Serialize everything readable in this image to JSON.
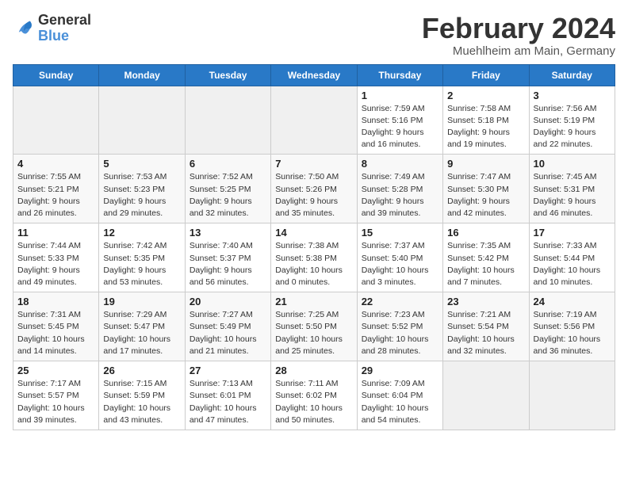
{
  "header": {
    "logo_line1": "General",
    "logo_line2": "Blue",
    "month_title": "February 2024",
    "location": "Muehlheim am Main, Germany"
  },
  "weekdays": [
    "Sunday",
    "Monday",
    "Tuesday",
    "Wednesday",
    "Thursday",
    "Friday",
    "Saturday"
  ],
  "weeks": [
    [
      {
        "day": "",
        "info": ""
      },
      {
        "day": "",
        "info": ""
      },
      {
        "day": "",
        "info": ""
      },
      {
        "day": "",
        "info": ""
      },
      {
        "day": "1",
        "info": "Sunrise: 7:59 AM\nSunset: 5:16 PM\nDaylight: 9 hours\nand 16 minutes."
      },
      {
        "day": "2",
        "info": "Sunrise: 7:58 AM\nSunset: 5:18 PM\nDaylight: 9 hours\nand 19 minutes."
      },
      {
        "day": "3",
        "info": "Sunrise: 7:56 AM\nSunset: 5:19 PM\nDaylight: 9 hours\nand 22 minutes."
      }
    ],
    [
      {
        "day": "4",
        "info": "Sunrise: 7:55 AM\nSunset: 5:21 PM\nDaylight: 9 hours\nand 26 minutes."
      },
      {
        "day": "5",
        "info": "Sunrise: 7:53 AM\nSunset: 5:23 PM\nDaylight: 9 hours\nand 29 minutes."
      },
      {
        "day": "6",
        "info": "Sunrise: 7:52 AM\nSunset: 5:25 PM\nDaylight: 9 hours\nand 32 minutes."
      },
      {
        "day": "7",
        "info": "Sunrise: 7:50 AM\nSunset: 5:26 PM\nDaylight: 9 hours\nand 35 minutes."
      },
      {
        "day": "8",
        "info": "Sunrise: 7:49 AM\nSunset: 5:28 PM\nDaylight: 9 hours\nand 39 minutes."
      },
      {
        "day": "9",
        "info": "Sunrise: 7:47 AM\nSunset: 5:30 PM\nDaylight: 9 hours\nand 42 minutes."
      },
      {
        "day": "10",
        "info": "Sunrise: 7:45 AM\nSunset: 5:31 PM\nDaylight: 9 hours\nand 46 minutes."
      }
    ],
    [
      {
        "day": "11",
        "info": "Sunrise: 7:44 AM\nSunset: 5:33 PM\nDaylight: 9 hours\nand 49 minutes."
      },
      {
        "day": "12",
        "info": "Sunrise: 7:42 AM\nSunset: 5:35 PM\nDaylight: 9 hours\nand 53 minutes."
      },
      {
        "day": "13",
        "info": "Sunrise: 7:40 AM\nSunset: 5:37 PM\nDaylight: 9 hours\nand 56 minutes."
      },
      {
        "day": "14",
        "info": "Sunrise: 7:38 AM\nSunset: 5:38 PM\nDaylight: 10 hours\nand 0 minutes."
      },
      {
        "day": "15",
        "info": "Sunrise: 7:37 AM\nSunset: 5:40 PM\nDaylight: 10 hours\nand 3 minutes."
      },
      {
        "day": "16",
        "info": "Sunrise: 7:35 AM\nSunset: 5:42 PM\nDaylight: 10 hours\nand 7 minutes."
      },
      {
        "day": "17",
        "info": "Sunrise: 7:33 AM\nSunset: 5:44 PM\nDaylight: 10 hours\nand 10 minutes."
      }
    ],
    [
      {
        "day": "18",
        "info": "Sunrise: 7:31 AM\nSunset: 5:45 PM\nDaylight: 10 hours\nand 14 minutes."
      },
      {
        "day": "19",
        "info": "Sunrise: 7:29 AM\nSunset: 5:47 PM\nDaylight: 10 hours\nand 17 minutes."
      },
      {
        "day": "20",
        "info": "Sunrise: 7:27 AM\nSunset: 5:49 PM\nDaylight: 10 hours\nand 21 minutes."
      },
      {
        "day": "21",
        "info": "Sunrise: 7:25 AM\nSunset: 5:50 PM\nDaylight: 10 hours\nand 25 minutes."
      },
      {
        "day": "22",
        "info": "Sunrise: 7:23 AM\nSunset: 5:52 PM\nDaylight: 10 hours\nand 28 minutes."
      },
      {
        "day": "23",
        "info": "Sunrise: 7:21 AM\nSunset: 5:54 PM\nDaylight: 10 hours\nand 32 minutes."
      },
      {
        "day": "24",
        "info": "Sunrise: 7:19 AM\nSunset: 5:56 PM\nDaylight: 10 hours\nand 36 minutes."
      }
    ],
    [
      {
        "day": "25",
        "info": "Sunrise: 7:17 AM\nSunset: 5:57 PM\nDaylight: 10 hours\nand 39 minutes."
      },
      {
        "day": "26",
        "info": "Sunrise: 7:15 AM\nSunset: 5:59 PM\nDaylight: 10 hours\nand 43 minutes."
      },
      {
        "day": "27",
        "info": "Sunrise: 7:13 AM\nSunset: 6:01 PM\nDaylight: 10 hours\nand 47 minutes."
      },
      {
        "day": "28",
        "info": "Sunrise: 7:11 AM\nSunset: 6:02 PM\nDaylight: 10 hours\nand 50 minutes."
      },
      {
        "day": "29",
        "info": "Sunrise: 7:09 AM\nSunset: 6:04 PM\nDaylight: 10 hours\nand 54 minutes."
      },
      {
        "day": "",
        "info": ""
      },
      {
        "day": "",
        "info": ""
      }
    ]
  ]
}
